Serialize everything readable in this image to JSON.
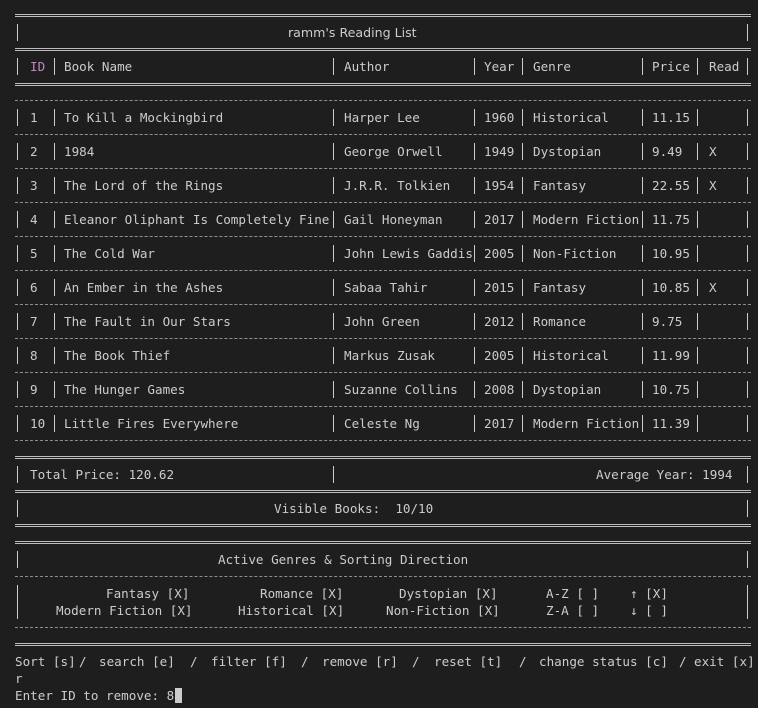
{
  "title": "ramm's Reading List",
  "columns": {
    "id": "ID",
    "name": "Book Name",
    "author": "Author",
    "year": "Year",
    "genre": "Genre",
    "price": "Price",
    "read": "Read"
  },
  "books": [
    {
      "id": "1",
      "name": "To Kill a Mockingbird",
      "author": "Harper Lee",
      "year": "1960",
      "genre": "Historical",
      "price": "11.15",
      "read": ""
    },
    {
      "id": "2",
      "name": "1984",
      "author": "George Orwell",
      "year": "1949",
      "genre": "Dystopian",
      "price": "9.49",
      "read": "X"
    },
    {
      "id": "3",
      "name": "The Lord of the Rings",
      "author": "J.R.R. Tolkien",
      "year": "1954",
      "genre": "Fantasy",
      "price": "22.55",
      "read": "X"
    },
    {
      "id": "4",
      "name": "Eleanor Oliphant Is Completely Fine",
      "author": "Gail Honeyman",
      "year": "2017",
      "genre": "Modern Fiction",
      "price": "11.75",
      "read": ""
    },
    {
      "id": "5",
      "name": "The Cold War",
      "author": "John Lewis Gaddis",
      "year": "2005",
      "genre": "Non-Fiction",
      "price": "10.95",
      "read": ""
    },
    {
      "id": "6",
      "name": "An Ember in the Ashes",
      "author": "Sabaa Tahir",
      "year": "2015",
      "genre": "Fantasy",
      "price": "10.85",
      "read": "X"
    },
    {
      "id": "7",
      "name": "The Fault in Our Stars",
      "author": "John Green",
      "year": "2012",
      "genre": "Romance",
      "price": "9.75",
      "read": ""
    },
    {
      "id": "8",
      "name": "The Book Thief",
      "author": "Markus Zusak",
      "year": "2005",
      "genre": "Historical",
      "price": "11.99",
      "read": ""
    },
    {
      "id": "9",
      "name": "The Hunger Games",
      "author": "Suzanne Collins",
      "year": "2008",
      "genre": "Dystopian",
      "price": "10.75",
      "read": ""
    },
    {
      "id": "10",
      "name": "Little Fires Everywhere",
      "author": "Celeste Ng",
      "year": "2017",
      "genre": "Modern Fiction",
      "price": "11.39",
      "read": ""
    }
  ],
  "summary": {
    "total_price": "Total Price: 120.62",
    "average_year": "Average Year: 1994",
    "visible_books": "Visible Books:  10/10"
  },
  "filters": {
    "title": "Active Genres & Sorting Direction",
    "row1": [
      {
        "label": "Fantasy [X]"
      },
      {
        "label": "Romance [X]"
      },
      {
        "label": "Dystopian [X]"
      },
      {
        "label": "A-Z [ ]"
      },
      {
        "label": "↑ [X]"
      }
    ],
    "row2": [
      {
        "label": "Modern Fiction [X]"
      },
      {
        "label": "Historical [X]"
      },
      {
        "label": "Non-Fiction [X]"
      },
      {
        "label": "Z-A [ ]"
      },
      {
        "label": "↓ [ ]"
      }
    ]
  },
  "commands": [
    {
      "label": "Sort [s]"
    },
    {
      "label": "search [e]"
    },
    {
      "label": "filter [f]"
    },
    {
      "label": "remove [r]"
    },
    {
      "label": "reset [t]"
    },
    {
      "label": "change status [c]"
    },
    {
      "label": "exit [x]"
    }
  ],
  "console": {
    "echo": "r",
    "prompt": "Enter ID to remove: ",
    "input_value": "8"
  },
  "colors": {
    "background": "#1e1e1e",
    "text": "#cccccc",
    "id_header": "#c586c0"
  }
}
